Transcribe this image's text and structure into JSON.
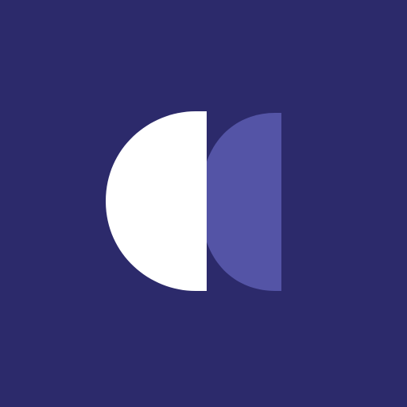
{
  "app_icon": {
    "icon_name": "half-circles-logo-icon",
    "colors": {
      "background": "#2c2a6b",
      "front_shape": "#ffffff",
      "back_shape": "#5454a6"
    }
  }
}
